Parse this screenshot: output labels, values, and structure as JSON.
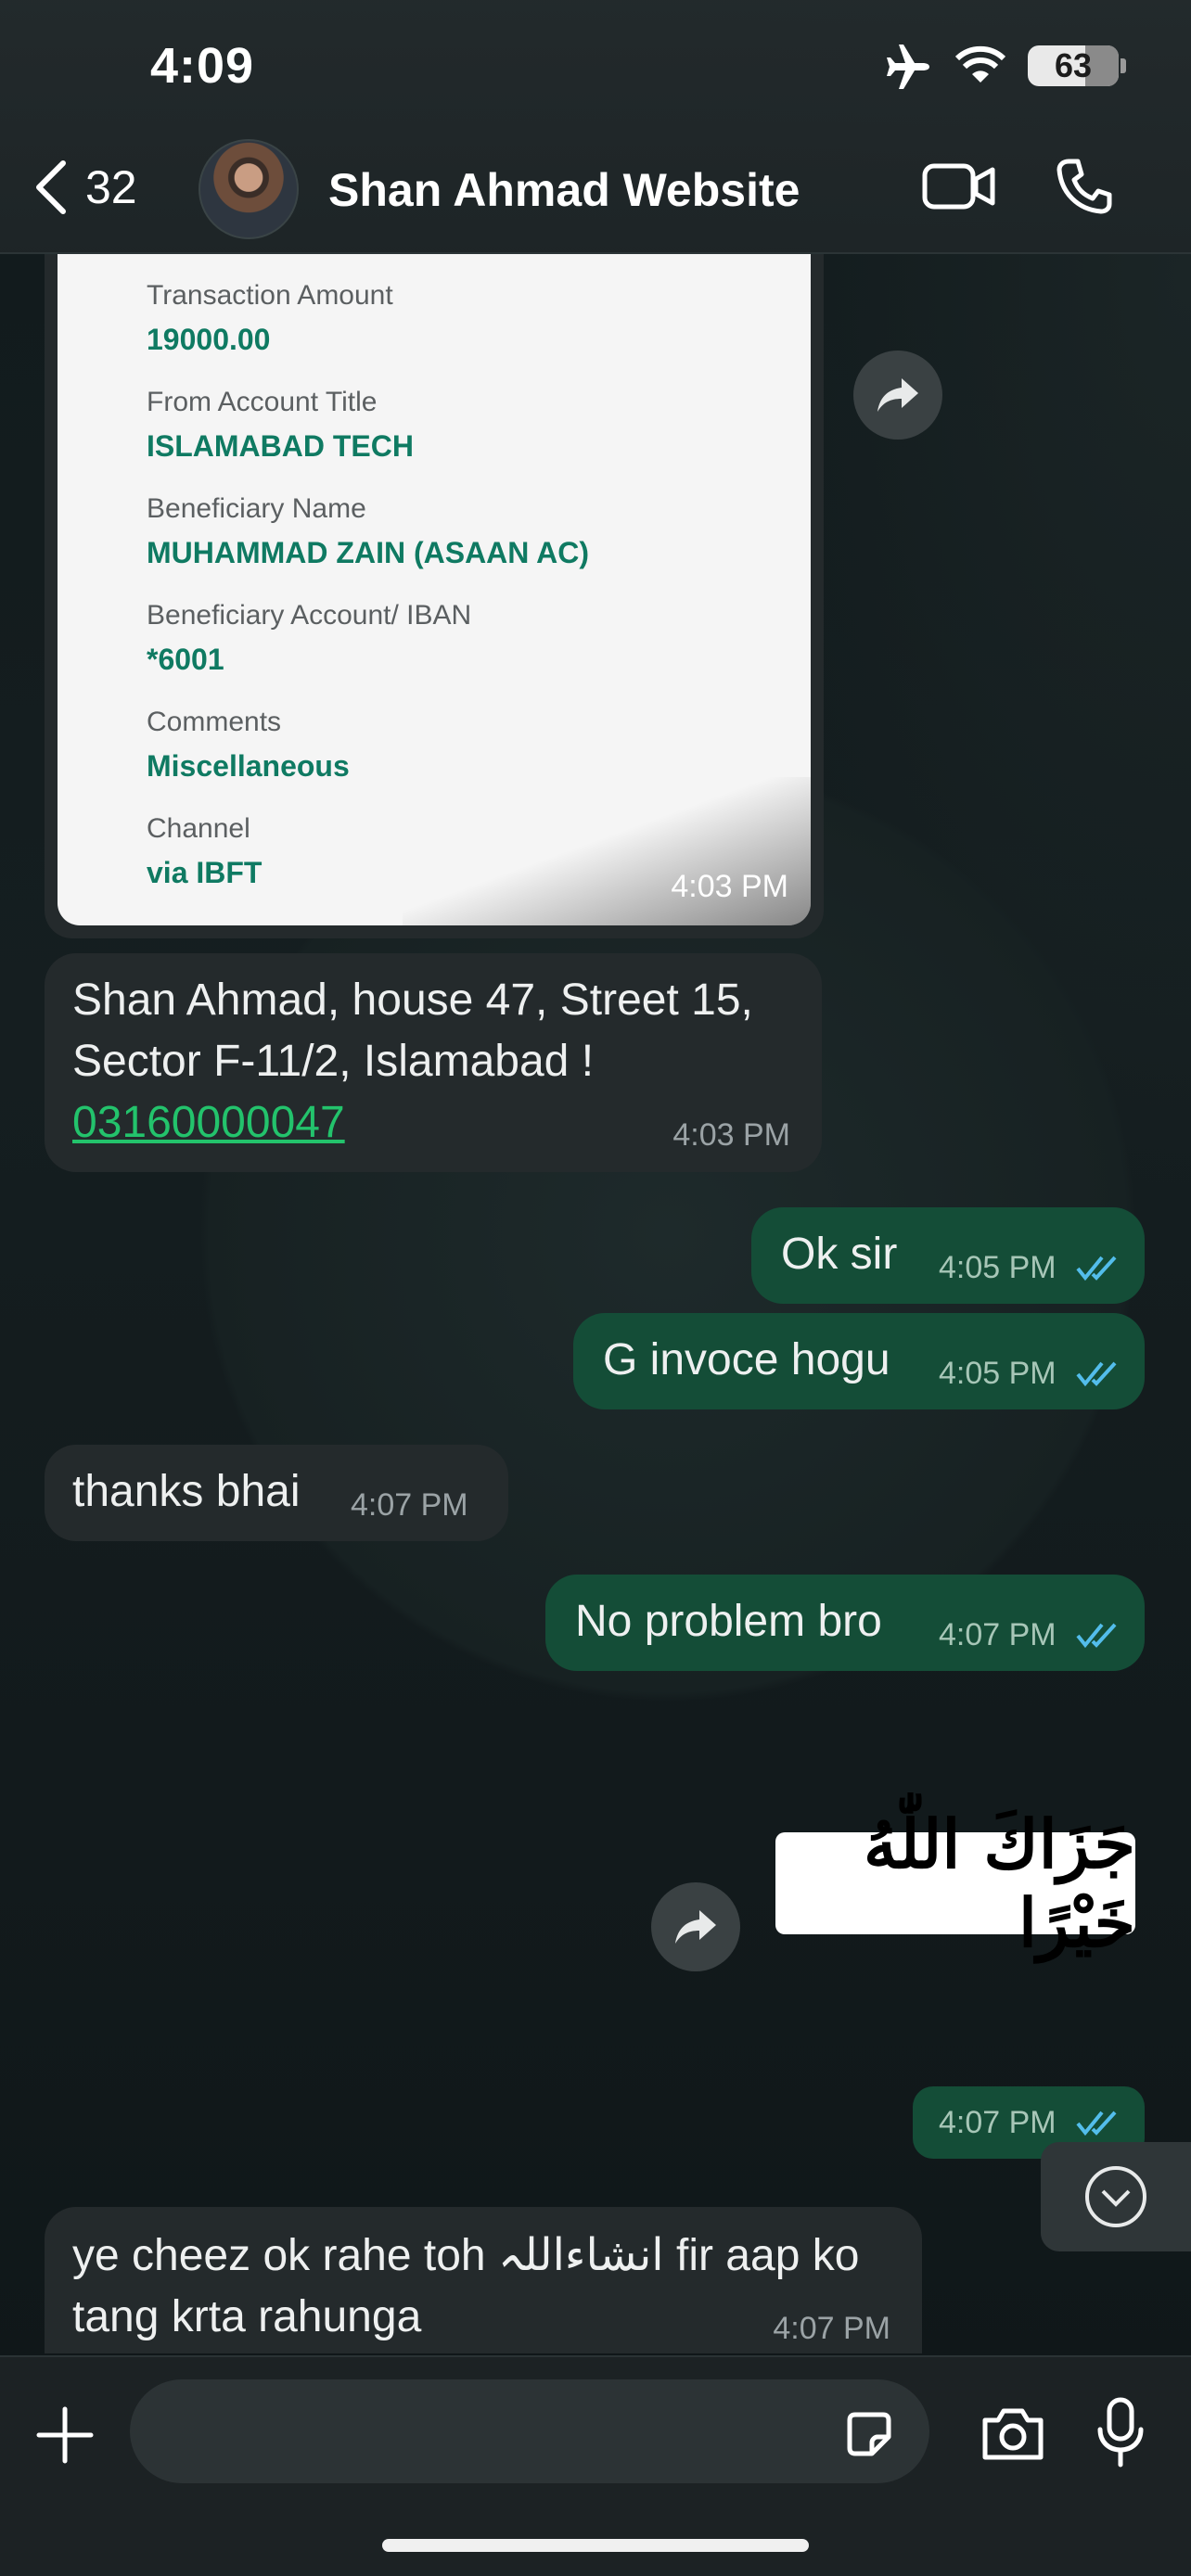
{
  "status_bar": {
    "time": "4:09",
    "battery": "63"
  },
  "header": {
    "back_count": "32",
    "contact_name": "Shan Ahmad Website"
  },
  "receipt": {
    "fields": [
      {
        "label": "Transaction Amount",
        "value": "19000.00"
      },
      {
        "label": "From Account Title",
        "value": "ISLAMABAD TECH"
      },
      {
        "label": "Beneficiary Name",
        "value": "MUHAMMAD ZAIN (ASAAN AC)"
      },
      {
        "label": "Beneficiary Account/ IBAN",
        "value": "*6001"
      },
      {
        "label": "Comments",
        "value": "Miscellaneous"
      },
      {
        "label": "Channel",
        "value": "via IBFT"
      }
    ],
    "time": "4:03 PM"
  },
  "messages": [
    {
      "direction": "in",
      "line1": "Shan Ahmad, house 47, Street 15,",
      "line2": "Sector F-11/2, Islamabad !",
      "link": "03160000047",
      "time": "4:03 PM"
    },
    {
      "direction": "out",
      "text": "Ok sir",
      "time": "4:05 PM",
      "status": "read"
    },
    {
      "direction": "out",
      "text": "G invoce hogu",
      "time": "4:05 PM",
      "status": "read"
    },
    {
      "direction": "in",
      "text": "thanks bhai",
      "time": "4:07 PM"
    },
    {
      "direction": "out",
      "text": "No problem bro",
      "time": "4:07 PM",
      "status": "read"
    },
    {
      "direction": "out",
      "sticker_text": "جَزَاكَ اللّٰهُ خَيْرًا"
    },
    {
      "direction": "out",
      "text": "",
      "time": "4:07 PM",
      "status": "read"
    },
    {
      "direction": "in",
      "line1": "ye cheez ok rahe toh انشاءاللہ fir aap ko",
      "line2": "tang krta rahunga",
      "time": "4:07 PM"
    }
  ],
  "composer": {
    "placeholder": "",
    "value": ""
  },
  "colors": {
    "incoming_bubble": "#242a2c",
    "outgoing_bubble": "#144d37",
    "link": "#23c36c",
    "read_ticks": "#53bdeb",
    "receipt_value": "#0f7a62"
  }
}
